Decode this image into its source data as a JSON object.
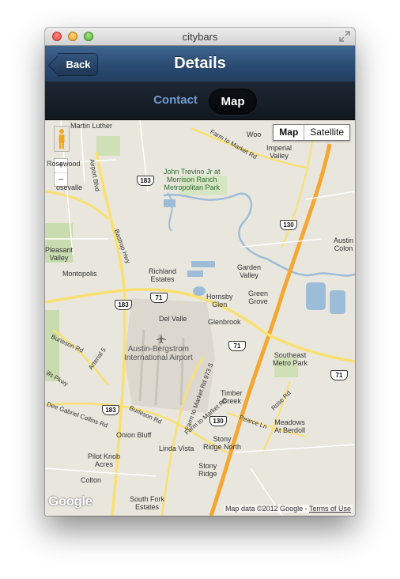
{
  "window": {
    "title": "citybars",
    "accent": "#2a4b72"
  },
  "nav": {
    "back_label": "Back",
    "title": "Details"
  },
  "segments": {
    "contact": "Contact",
    "map": "Map",
    "selected": "Map"
  },
  "map": {
    "type_map": "Map",
    "type_satellite": "Satellite",
    "zoom_in": "+",
    "zoom_out": "−",
    "logo": "Google",
    "attribution": "Map data ©2012 Google -",
    "terms": "Terms of Use",
    "places": {
      "woo": "Woo",
      "martin_luther": "Martin Luther",
      "farm_to_market_top": "Farm to Market Rd",
      "imperial_valley": "Imperial\nValley",
      "rosewood": "Rosewood",
      "airport_blvd": "Airport Blvd",
      "john_trevino": "John Trevino Jr at\nMorrison Ranch\nMetropolitan Park",
      "rosevalle": "osevalle",
      "austin_colony": "Austin\nColon",
      "pleasant_valley": "Pleasant\nValley",
      "bastrop_hwy": "Bastrop Hwy",
      "montopolis": "Montopolis",
      "richland_estates": "Richland\nEstates",
      "garden_valley": "Garden\nValley",
      "hornsby_glen": "Hornsby\nGlen",
      "green_grove": "Green\nGrove",
      "del_valle": "Del Valle",
      "glenbrook": "Glenbrook",
      "airport": "Austin-Bergstrom\nInternational Airport",
      "burleson_rd_left": "Burleson Rd",
      "arterial_5": "Arterial 5",
      "ills_pkwy": "ills Pkwy",
      "southeast_metro_park": "Southeast\nMetro Park",
      "farm_to_market_973": "Farm to Market Rd 973 S",
      "timber_creek": "Timber\nCreek",
      "rose_rd": "Rose Rd",
      "dee_gabriel": "Dee Gabriel Collins Rd",
      "burleson_rd_bottom": "Burleson Rd",
      "farm_to_market_bottom": "Farm to Market Rd",
      "pearce_ln": "Pearce Ln",
      "meadows": "Meadows\nAt Berdoll",
      "onion_bluff": "Onion Bluff",
      "linda_vista": "Linda Vista",
      "stony_ridge_north": "Stony\nRidge North",
      "pilot_knob": "Pilot Knob\nAcres",
      "stony_ridge": "Stony\nRidge",
      "colton": "Colton",
      "south_fork": "South Fork\nEstates"
    },
    "shields": {
      "s183_top": "183",
      "s130_top": "130",
      "s183_mid": "183",
      "s71_mid": "71",
      "s71_right": "71",
      "s71_lower": "71",
      "s183_bottom": "183",
      "s130_bottom": "130"
    }
  }
}
